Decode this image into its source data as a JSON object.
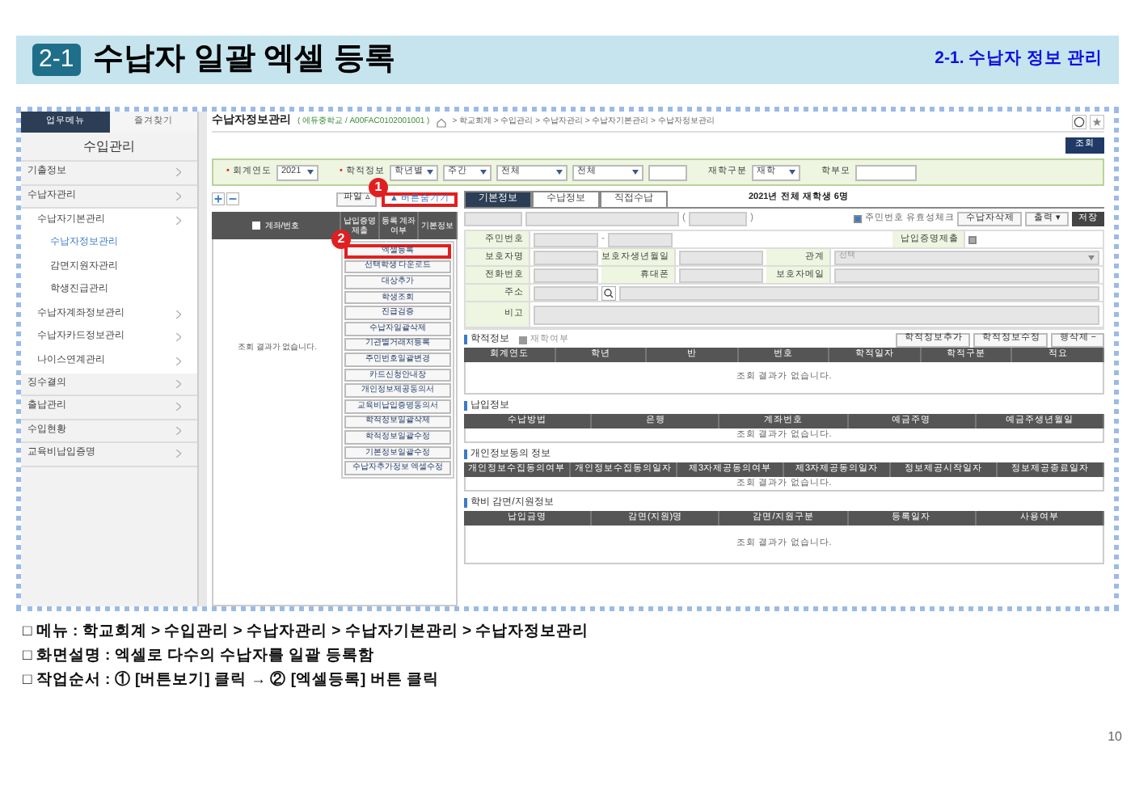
{
  "header": {
    "badge": "2-1",
    "title": "수납자 일괄 엑셀 등록",
    "section": "2-1. 수납자 정보 관리"
  },
  "sidebar": {
    "tabs": [
      {
        "label": "업무메뉴",
        "selected": true
      },
      {
        "label": "즐겨찾기",
        "selected": false
      }
    ],
    "title": "수입관리",
    "items": [
      {
        "label": "기출정보",
        "arrow": true,
        "selected": false
      },
      {
        "label": "수납자관리",
        "arrow": true,
        "selected": false,
        "children": [
          {
            "label": "수납자기본관리",
            "arrow": true,
            "selected": false,
            "children": [
              {
                "label": "수납자정보관리",
                "arrow": false,
                "selected": true
              },
              {
                "label": "감면지원자관리",
                "arrow": false,
                "selected": false
              },
              {
                "label": "학생진급관리",
                "arrow": false,
                "selected": false
              }
            ]
          },
          {
            "label": "수납자계좌정보관리",
            "arrow": true,
            "selected": false
          },
          {
            "label": "수납자카드정보관리",
            "arrow": true,
            "selected": false
          },
          {
            "label": "나이스연계관리",
            "arrow": true,
            "selected": false
          }
        ]
      },
      {
        "label": "징수결의",
        "arrow": true,
        "selected": false
      },
      {
        "label": "출납관리",
        "arrow": true,
        "selected": false
      },
      {
        "label": "수입현황",
        "arrow": true,
        "selected": false
      },
      {
        "label": "교육비납입증명",
        "arrow": true,
        "selected": false
      }
    ]
  },
  "page_title": "수납자정보관리",
  "context": "( 에듀중학교 / A00FAC0102001001 )",
  "breadcrumb": "> 학교회계 > 수입관리 > 수납자관리 > 수납자기본관리 > 수납자정보관리",
  "search_button": "조회",
  "required_mark": "•",
  "filters": [
    {
      "kind": "select",
      "label": "회계연도",
      "required": true,
      "value": "2021"
    },
    {
      "kind": "select",
      "label": "학적정보",
      "required": true,
      "value": "학년별"
    },
    {
      "kind": "select",
      "value": "주간"
    },
    {
      "kind": "select",
      "value": "전체"
    },
    {
      "kind": "select",
      "value": "전체"
    },
    {
      "kind": "input"
    },
    {
      "kind": "select",
      "label": "재학구분",
      "required": false,
      "value": "재학"
    },
    {
      "kind": "input",
      "label": "학부모",
      "required": false
    }
  ],
  "grid": {
    "header_checked": false,
    "columns": [
      "계좌/번호",
      "납입증명 제출",
      "등록 계좌여부",
      "기본정보"
    ],
    "empty": "조회 결과가 없습니다."
  },
  "file_button": "파일 ▵",
  "toggle_button": {
    "label": "▲ 버튼숨기기",
    "highlighted": true,
    "step": "1"
  },
  "action_buttons": [
    {
      "label": "엑셀등록",
      "highlighted": true,
      "step": "2"
    },
    {
      "label": "선택학생 다운로드",
      "highlighted": false
    },
    {
      "label": "대상추가",
      "highlighted": false
    },
    {
      "label": "학생조회",
      "highlighted": false
    },
    {
      "label": "진급검증",
      "highlighted": false
    },
    {
      "label": "수납자일괄삭제",
      "highlighted": false
    },
    {
      "label": "기관별거래처등록",
      "highlighted": false
    },
    {
      "label": "주민번호일괄변경",
      "highlighted": false
    },
    {
      "label": "카드신청안내장",
      "highlighted": false
    },
    {
      "label": "개인정보제공동의서",
      "highlighted": false
    },
    {
      "label": "교육비납입증명동의서",
      "highlighted": false
    },
    {
      "label": "학적정보일괄삭제",
      "highlighted": false
    },
    {
      "label": "학적정보일괄수정",
      "highlighted": false
    },
    {
      "label": "기본정보일괄수정",
      "highlighted": false
    },
    {
      "label": "수납자추가정보 엑셀수정",
      "highlighted": false
    }
  ],
  "tabs": [
    {
      "label": "기본정보",
      "selected": true
    },
    {
      "label": "수납정보",
      "selected": false
    },
    {
      "label": "직접수납",
      "selected": false
    }
  ],
  "summary": "2021년 전체 재학생 6명",
  "paren_open": "(",
  "paren_close": ")",
  "id_check": {
    "label": "주민번호 유효성체크",
    "checked": true
  },
  "buttons": [
    {
      "label": "수납자삭제",
      "kind": "plain"
    },
    {
      "label": "출력 ▾",
      "kind": "plain"
    },
    {
      "label": "저장",
      "kind": "primary"
    }
  ],
  "form": {
    "labels": [
      "주민번호",
      "납입증명제출",
      "보호자명",
      "보호자생년월일",
      "관계",
      "전화번호",
      "휴대폰",
      "보호자메일",
      "주소",
      "비고"
    ],
    "id_separator": "-",
    "proof_checked": false,
    "relation_placeholder": "선택"
  },
  "sections": [
    {
      "title": "학적정보",
      "legend": "재학여부",
      "buttons": [
        "학적정보추가",
        "학적정보수정",
        "행삭제 −"
      ],
      "columns": [
        "회계연도",
        "학년",
        "반",
        "번호",
        "학적일자",
        "학적구분",
        "적요"
      ],
      "empty": "조회 결과가 없습니다."
    },
    {
      "title": "납입정보",
      "columns": [
        "수납방법",
        "은행",
        "계좌번호",
        "예금주명",
        "예금주생년월일"
      ],
      "empty": "조회 결과가 없습니다."
    },
    {
      "title": "개인정보동의 정보",
      "columns": [
        "개인정보수집동의여부",
        "개인정보수집동의일자",
        "제3자제공동의여부",
        "제3자제공동의일자",
        "정보제공시작일자",
        "정보제공종료일자"
      ],
      "empty": "조회 결과가 없습니다."
    },
    {
      "title": "학비 감면/지원정보",
      "columns": [
        "납입금명",
        "감면(지원)명",
        "감면/지원구분",
        "등록일자",
        "사용여부"
      ],
      "empty": "조회 결과가 없습니다."
    }
  ],
  "notes": [
    "□ 메뉴 : 학교회계 > 수입관리 > 수납자관리 > 수납자기본관리 > 수납자정보관리",
    "□ 화면설명 : 엑셀로 다수의 수납자를 일괄 등록함",
    "□ 작업순서 : ① [버튼보기] 클릭 → ② [엑셀등록] 버튼 클릭"
  ],
  "page_number": "10"
}
